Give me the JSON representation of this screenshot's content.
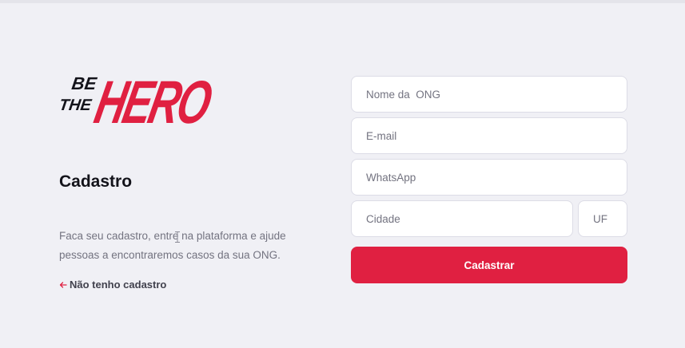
{
  "brand": {
    "line1": "BE",
    "line2": "THE",
    "word": "HERO",
    "color": "#e02041"
  },
  "page": {
    "title": "Cadastro",
    "description": "Faca seu cadastro, entre na plataforma e ajude pessoas a encontraremos casos da sua ONG.",
    "back_link_label": "Não tenho cadastro",
    "back_icon": "arrow-left-icon"
  },
  "form": {
    "name_placeholder": "Nome da  ONG",
    "email_placeholder": "E-mail",
    "whatsapp_placeholder": "WhatsApp",
    "city_placeholder": "Cidade",
    "uf_placeholder": "UF",
    "submit_label": "Cadastrar"
  },
  "colors": {
    "accent": "#e02041",
    "background": "#f0f0f5",
    "text_dark": "#13131a",
    "text_muted": "#737380"
  }
}
